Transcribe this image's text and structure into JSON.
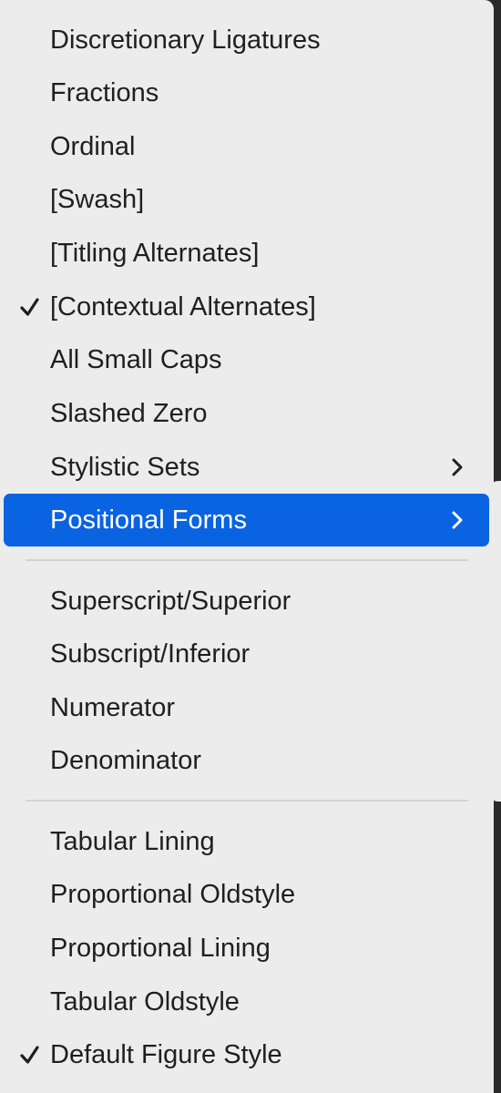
{
  "menu": {
    "group1": [
      {
        "label": "Discretionary Ligatures",
        "checked": false
      },
      {
        "label": "Fractions",
        "checked": false
      },
      {
        "label": "Ordinal",
        "checked": false
      },
      {
        "label": "[Swash]",
        "checked": false
      },
      {
        "label": "[Titling Alternates]",
        "checked": false
      },
      {
        "label": "[Contextual Alternates]",
        "checked": true
      },
      {
        "label": "All Small Caps",
        "checked": false
      },
      {
        "label": "Slashed Zero",
        "checked": false
      },
      {
        "label": "Stylistic Sets",
        "checked": false,
        "submenu": true
      },
      {
        "label": "Positional Forms",
        "checked": false,
        "submenu": true,
        "highlighted": true
      }
    ],
    "group2": [
      {
        "label": "Superscript/Superior",
        "checked": false
      },
      {
        "label": "Subscript/Inferior",
        "checked": false
      },
      {
        "label": "Numerator",
        "checked": false
      },
      {
        "label": "Denominator",
        "checked": false
      }
    ],
    "group3": [
      {
        "label": "Tabular Lining",
        "checked": false
      },
      {
        "label": "Proportional Oldstyle",
        "checked": false
      },
      {
        "label": "Proportional Lining",
        "checked": false
      },
      {
        "label": "Tabular Oldstyle",
        "checked": false
      },
      {
        "label": "Default Figure Style",
        "checked": true
      }
    ]
  },
  "colors": {
    "menu_background": "#ececec",
    "highlight": "#0a63e0",
    "text": "#1f1f1f",
    "separator": "#d3d3d3"
  },
  "icons": {
    "check": "checkmark-icon",
    "submenu": "chevron-right-icon"
  }
}
